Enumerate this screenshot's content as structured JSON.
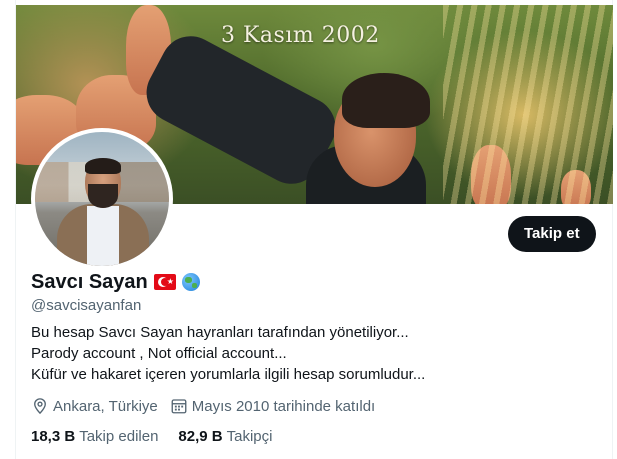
{
  "banner": {
    "title": "3 Kasım 2002"
  },
  "profile": {
    "display_name": "Savcı Sayan",
    "handle": "@savcisayanfan",
    "follow_label": "Takip et",
    "bio_lines": [
      "Bu hesap Savcı Sayan hayranları tarafından yönetiliyor...",
      "Parody account , Not official account...",
      "Küfür ve hakaret içeren yorumlarla ilgili hesap sorumludur..."
    ],
    "location": "Ankara, Türkiye",
    "joined": "Mayıs 2010 tarihinde katıldı",
    "following_count": "18,3 B",
    "following_label": "Takip edilen",
    "followers_count": "82,9 B",
    "followers_label": "Takipçi"
  },
  "icons": {
    "flag": "turkey-flag-icon",
    "globe": "globe-icon",
    "location": "location-pin-icon",
    "calendar": "calendar-icon"
  },
  "colors": {
    "text_primary": "#0f1419",
    "text_secondary": "#536471",
    "button_bg": "#0f1419",
    "button_text": "#ffffff"
  }
}
